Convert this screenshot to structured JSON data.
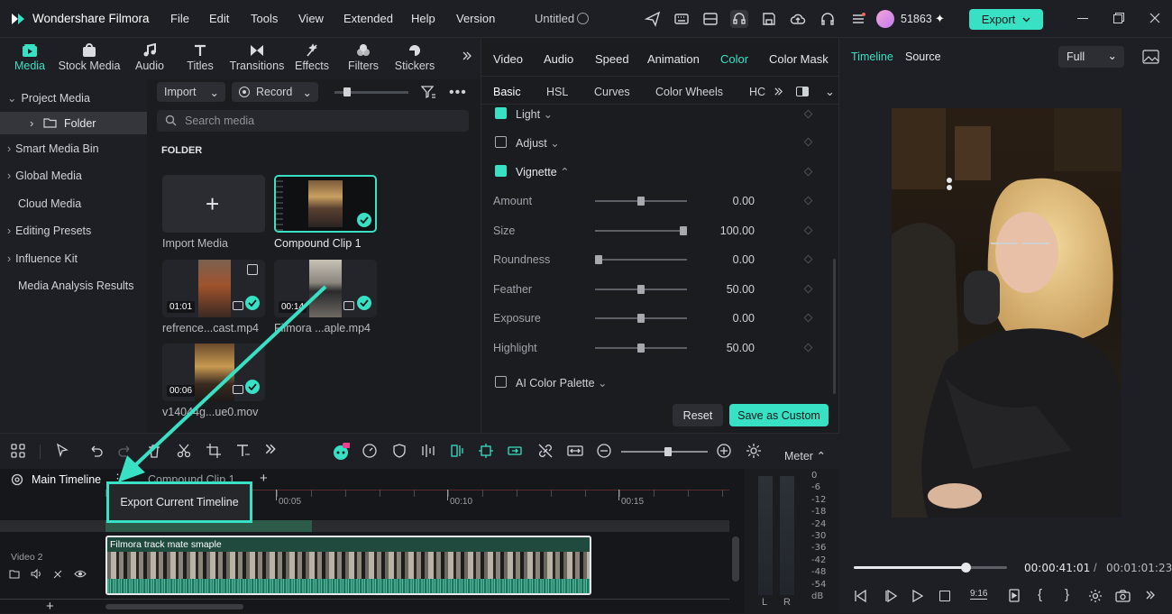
{
  "app": {
    "name": "Wondershare Filmora",
    "project_title": "Untitled",
    "credits": "51863",
    "export_label": "Export"
  },
  "menu": [
    "File",
    "Edit",
    "Tools",
    "View",
    "Extended",
    "Help",
    "Version"
  ],
  "media_tabs": [
    {
      "label": "Media",
      "icon": "media-icon"
    },
    {
      "label": "Stock Media",
      "icon": "stock-media-icon"
    },
    {
      "label": "Audio",
      "icon": "music-note-icon"
    },
    {
      "label": "Titles",
      "icon": "text-t-icon"
    },
    {
      "label": "Transitions",
      "icon": "transitions-icon"
    },
    {
      "label": "Effects",
      "icon": "effects-icon"
    },
    {
      "label": "Filters",
      "icon": "filters-icon"
    },
    {
      "label": "Stickers",
      "icon": "stickers-icon"
    }
  ],
  "sidebar": {
    "items": [
      "Project Media",
      "Folder",
      "Smart Media Bin",
      "Global Media",
      "Cloud Media",
      "Editing Presets",
      "Influence Kit",
      "Media Analysis Results"
    ]
  },
  "library": {
    "import_label": "Import",
    "record_label": "Record",
    "search_placeholder": "Search media",
    "folder_heading": "FOLDER",
    "items": [
      {
        "name": "Import Media"
      },
      {
        "name": "Compound Clip 1"
      },
      {
        "name": "refrence...cast.mp4",
        "duration": "01:01"
      },
      {
        "name": "Filmora ...aple.mp4",
        "duration": "00:14"
      },
      {
        "name": "v14044g...ue0.mov",
        "duration": "00:06"
      }
    ]
  },
  "props": {
    "tabs": [
      "Video",
      "Audio",
      "Speed",
      "Animation",
      "Color",
      "Color Mask"
    ],
    "active_tab": "Color",
    "subtabs": [
      "Basic",
      "HSL",
      "Curves",
      "Color Wheels",
      "HC"
    ],
    "sections": {
      "light": "Light",
      "adjust": "Adjust",
      "vignette": "Vignette",
      "ai_palette": "AI Color Palette"
    },
    "vignette": [
      {
        "label": "Amount",
        "value": "0.00",
        "level": 0.5
      },
      {
        "label": "Size",
        "value": "100.00",
        "level": 1.0
      },
      {
        "label": "Roundness",
        "value": "0.00",
        "level": 0.0
      },
      {
        "label": "Feather",
        "value": "50.00",
        "level": 0.5
      },
      {
        "label": "Exposure",
        "value": "0.00",
        "level": 0.5
      },
      {
        "label": "Highlight",
        "value": "50.00",
        "level": 0.5
      }
    ],
    "reset_label": "Reset",
    "save_custom_label": "Save as Custom"
  },
  "preview": {
    "tabs": [
      "Timeline",
      "Source"
    ],
    "quality": "Full",
    "current_time": "00:00:41:01",
    "separator": "/",
    "total_time": "00:01:01:23",
    "progress": 0.73
  },
  "timeline": {
    "meter_label": "Meter",
    "tabs": [
      "Main Timeline",
      "Compound Clip 1"
    ],
    "popup": "Export Current Timeline",
    "ruler": [
      "00:05",
      "00:10",
      "00:15"
    ],
    "track_label": "Video 2",
    "clip_name": "Filmora track mate smaple",
    "meter_scale": [
      "0",
      "-6",
      "-12",
      "-18",
      "-24",
      "-30",
      "-36",
      "-42",
      "-48",
      "-54",
      "dB"
    ],
    "meter_channels": [
      "L",
      "R"
    ]
  },
  "colors": {
    "accent": "#38e0c4",
    "bg": "#1b1c20"
  }
}
